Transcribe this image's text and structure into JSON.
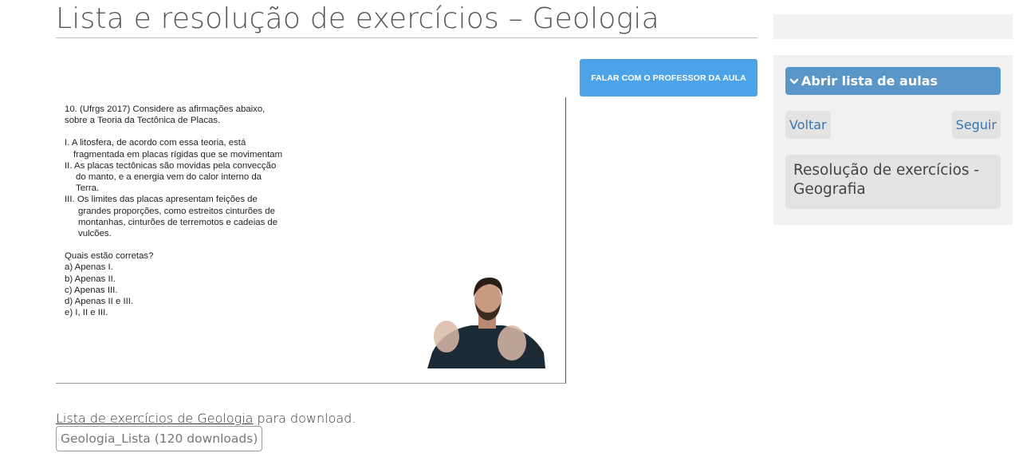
{
  "page": {
    "title": "Lista e resolução de exercícios – Geologia"
  },
  "professor_button": {
    "label": "FALAR COM O PROFESSOR DA AULA"
  },
  "video": {
    "question_lines": [
      "10. (Ufrgs 2017)  Considere as afirmações abaixo,",
      "sobre a Teoria da Tectônica de Placas.",
      "I. A litosfera, de acordo com essa teoria, está",
      "fragmentada em placas rígidas que se movimentam",
      "II. As placas tectônicas são movidas pela convecção",
      "do manto, e a energia vem do calor interno da",
      "Terra.",
      "III. Os limites das placas apresentam feições de",
      "grandes proporções, como estreitos cinturões de",
      "montanhas, cinturões de terremotos e cadeias de",
      "vulcões.",
      "Quais estão corretas?",
      "a) Apenas I.",
      "b) Apenas II.",
      "c) Apenas III.",
      "d) Apenas II e III.",
      "e) I, II e III."
    ]
  },
  "download": {
    "link_text": "Lista de exercícios de Geologia",
    "suffix_text": " para download.",
    "button_label": "Geologia_Lista (120 downloads)"
  },
  "sidebar": {
    "open_list_label": "Abrir lista de aulas",
    "open_list_icon": "chevron-down-icon",
    "prev_label": "Voltar",
    "next_label": "Seguir",
    "next_lesson_title": "Resolução de exercícios - Geografia"
  },
  "colors": {
    "button_blue": "#4da3e8",
    "sidebar_blue": "#5b96c8",
    "link_blue": "#3a75ad",
    "sidebar_bg": "#f1f1f1"
  }
}
